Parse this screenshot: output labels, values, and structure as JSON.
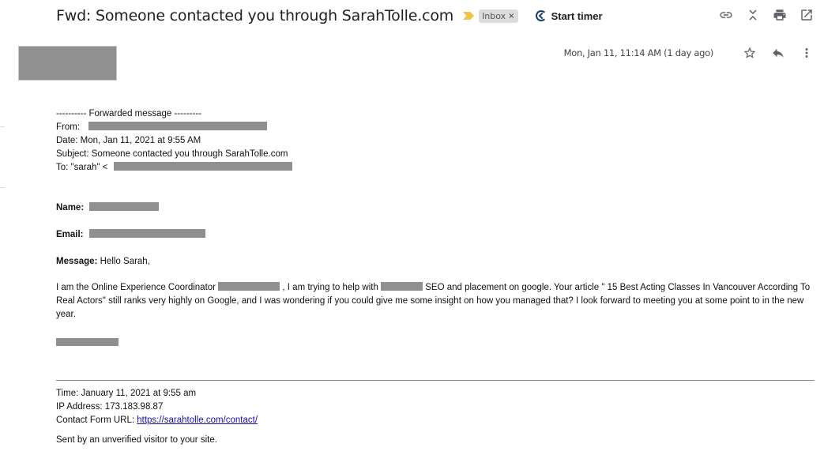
{
  "header": {
    "subject": "Fwd: Someone contacted you through SarahTolle.com",
    "label": "Inbox",
    "label_remove": "×",
    "timer_label": "Start timer",
    "icons": [
      "link-icon",
      "collapse-icon",
      "print-icon",
      "open-new-window-icon"
    ]
  },
  "message_meta": {
    "date": "Mon, Jan 11, 11:14 AM (1 day ago)",
    "icons": [
      "star-icon",
      "reply-icon",
      "more-vert-icon"
    ]
  },
  "forwarded": {
    "divider": "---------- Forwarded message ---------",
    "from_label": "From:",
    "date_line": "Date: Mon, Jan 11, 2021 at 9:55 AM",
    "subject_line": "Subject: Someone contacted you through SarahTolle.com",
    "to_label": "To: \"sarah\" <"
  },
  "form": {
    "name_label": "Name:",
    "email_label": "Email:",
    "message_label": "Message:",
    "message_greeting": " Hello Sarah,",
    "para_part1": "I am the Online Experience Coordinator ",
    "para_part2": " , I am trying to help with ",
    "para_part3": " SEO and placement on google. Your article \" 15 Best Acting Classes In Vancouver According To Real Actors\" still ranks very highly on Google, and I was wondering if you could give me some insight on how you managed that? I look forward to meeting you at some point to in the new year."
  },
  "footer": {
    "time": "Time: January 11, 2021 at 9:55 am",
    "ip": "IP Address: 173.183.98.87",
    "url_label": "Contact Form URL: ",
    "url": "https://sarahtolle.com/contact/",
    "note": "Sent by an unverified visitor to your site."
  }
}
